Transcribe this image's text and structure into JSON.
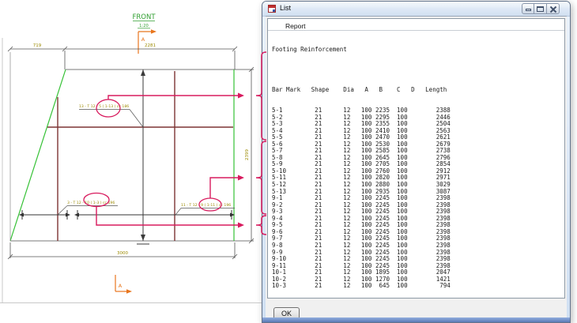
{
  "window": {
    "title": "List",
    "menu": {
      "report": "Report"
    },
    "controls": {
      "minimize": "minimize",
      "maximize": "maximize",
      "close": "close"
    },
    "report": {
      "heading": "Footing Reinforcement",
      "columns": [
        "Bar Mark",
        "Shape",
        "Dia",
        "A",
        "B",
        "C",
        "D",
        "Length"
      ],
      "header_line": "Bar Mark   Shape    Dia   A   B    C   D   Length",
      "rows": [
        [
          "5-1",
          "21",
          "12",
          "100",
          "2235",
          "100",
          "",
          "2388"
        ],
        [
          "5-2",
          "21",
          "12",
          "100",
          "2295",
          "100",
          "",
          "2446"
        ],
        [
          "5-3",
          "21",
          "12",
          "100",
          "2355",
          "100",
          "",
          "2504"
        ],
        [
          "5-4",
          "21",
          "12",
          "100",
          "2410",
          "100",
          "",
          "2563"
        ],
        [
          "5-5",
          "21",
          "12",
          "100",
          "2470",
          "100",
          "",
          "2621"
        ],
        [
          "5-6",
          "21",
          "12",
          "100",
          "2530",
          "100",
          "",
          "2679"
        ],
        [
          "5-7",
          "21",
          "12",
          "100",
          "2585",
          "100",
          "",
          "2738"
        ],
        [
          "5-8",
          "21",
          "12",
          "100",
          "2645",
          "100",
          "",
          "2796"
        ],
        [
          "5-9",
          "21",
          "12",
          "100",
          "2705",
          "100",
          "",
          "2854"
        ],
        [
          "5-10",
          "21",
          "12",
          "100",
          "2760",
          "100",
          "",
          "2912"
        ],
        [
          "5-11",
          "21",
          "12",
          "100",
          "2820",
          "100",
          "",
          "2971"
        ],
        [
          "5-12",
          "21",
          "12",
          "100",
          "2880",
          "100",
          "",
          "3029"
        ],
        [
          "5-13",
          "21",
          "12",
          "100",
          "2935",
          "100",
          "",
          "3087"
        ],
        [
          "9-1",
          "21",
          "12",
          "100",
          "2245",
          "100",
          "",
          "2398"
        ],
        [
          "9-2",
          "21",
          "12",
          "100",
          "2245",
          "100",
          "",
          "2398"
        ],
        [
          "9-3",
          "21",
          "12",
          "100",
          "2245",
          "100",
          "",
          "2398"
        ],
        [
          "9-4",
          "21",
          "12",
          "100",
          "2245",
          "100",
          "",
          "2398"
        ],
        [
          "9-5",
          "21",
          "12",
          "100",
          "2245",
          "100",
          "",
          "2398"
        ],
        [
          "9-6",
          "21",
          "12",
          "100",
          "2245",
          "100",
          "",
          "2398"
        ],
        [
          "9-7",
          "21",
          "12",
          "100",
          "2245",
          "100",
          "",
          "2398"
        ],
        [
          "9-8",
          "21",
          "12",
          "100",
          "2245",
          "100",
          "",
          "2398"
        ],
        [
          "9-9",
          "21",
          "12",
          "100",
          "2245",
          "100",
          "",
          "2398"
        ],
        [
          "9-10",
          "21",
          "12",
          "100",
          "2245",
          "100",
          "",
          "2398"
        ],
        [
          "9-11",
          "21",
          "12",
          "100",
          "2245",
          "100",
          "",
          "2398"
        ],
        [
          "10-1",
          "21",
          "12",
          "100",
          "1895",
          "100",
          "",
          "2047"
        ],
        [
          "10-2",
          "21",
          "12",
          "100",
          "1270",
          "100",
          "",
          "1421"
        ],
        [
          "10-3",
          "21",
          "12",
          "100",
          "645",
          "100",
          "",
          "794"
        ]
      ]
    },
    "ok_label": "OK"
  },
  "drawing": {
    "view_title": "FRONT",
    "view_scale": "1:20",
    "section_marker": "A",
    "dimensions": {
      "top_left": "719",
      "top_right": "2281",
      "bottom": "3000",
      "right": "2399"
    },
    "labels": {
      "bars_5": "13 - T 12 - 5 ( 1-13 ) cc 186",
      "bars_10": "3 - T 12 - 10 ( 1-3 ) cc 196",
      "bars_9": "11 - T 12 - 9 ( 1-11 ) cc 196"
    },
    "colors": {
      "outline_green": "#35c135",
      "rebar_maroon": "#7d3434",
      "annotation_red": "#d81b5e",
      "dim_text_olive": "#9c8a00",
      "marker_orange": "#e8761e"
    }
  }
}
